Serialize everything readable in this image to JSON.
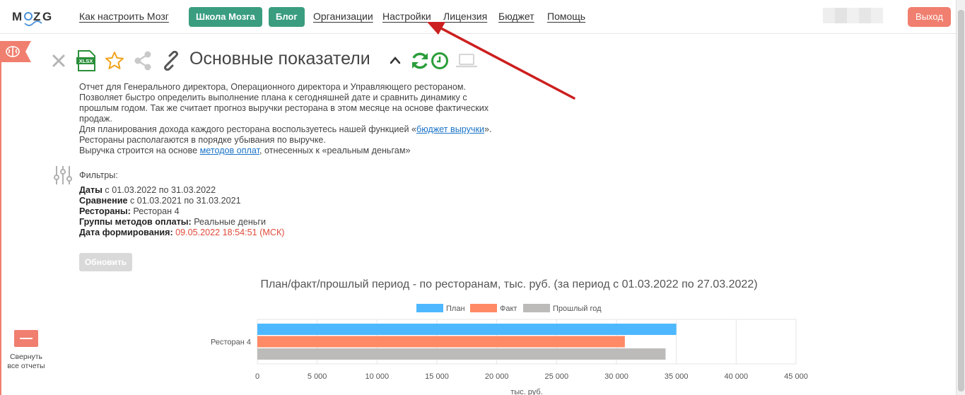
{
  "nav": {
    "logo": "MOZG",
    "link_howto": "Как настроить Мозг",
    "btn_school": "Школа Мозга",
    "btn_blog": "Блог",
    "link_orgs": "Организации",
    "link_settings": "Настройки",
    "link_license": "Лицензия",
    "link_budget": "Бюджет",
    "link_help": "Помощь",
    "logout": "Выход"
  },
  "report": {
    "title": "Основные показатели",
    "desc_lines": [
      "Отчет для Генерального директора, Операционного директора и Управляющего рестораном.",
      "Позволяет быстро определить выполнение плана к сегодняшней дате и сравнить динамику с",
      "прошлым годом. Так же считает прогноз выручки ресторана в этом месяце на основе фактических",
      "продаж."
    ],
    "desc_budget_prefix": "Для планирования дохода каждого ресторана воспользуетесь нашей функцией «",
    "desc_budget_link": "бюджет выручки",
    "desc_budget_suffix": "».",
    "desc_sort": "Рестораны располагаются в порядке убывания по выручке.",
    "desc_pay_prefix": "Выручка строится на основе ",
    "desc_pay_link": "методов оплат",
    "desc_pay_suffix": ", отнесенных к «реальным деньгам»"
  },
  "filters": {
    "title": "Фильтры:",
    "dates_label": "Даты",
    "dates_value": " с 01.03.2022 по 31.03.2022",
    "compare_label": "Сравнение",
    "compare_value": " с 01.03.2021 по 31.03.2021",
    "rest_label": "Рестораны:",
    "rest_value": " Ресторан 4",
    "paygroups_label": "Группы методов оплаты:",
    "paygroups_value": " Реальные деньги",
    "gen_label": "Дата формирования:",
    "gen_value": " 09.05.2022 18:54:51 (МСК)"
  },
  "buttons": {
    "refresh": "Обновить",
    "collapse_all": "Свернуть все отчеты"
  },
  "icons": {
    "close": "close-icon",
    "xlsx": "xlsx-icon",
    "star": "star-icon",
    "share": "share-icon",
    "link": "link-icon",
    "collapse": "chevron-up-icon",
    "refresh": "refresh-icon",
    "clock": "clock-icon",
    "laptop": "laptop-icon",
    "filters": "sliders-icon",
    "brain": "brain-icon"
  },
  "colors": {
    "accent_green": "#3a9d80",
    "logout": "#f07f6f",
    "plan": "#4db8ff",
    "fact": "#ff8a65",
    "prev": "#bdbaba",
    "annotation_arrow": "#cc1f1f"
  },
  "chart_data": {
    "type": "bar",
    "orientation": "horizontal",
    "title": "План/факт/прошлый период - по ресторанам, тыс. руб. (за период с 01.03.2022 по 27.03.2022)",
    "categories": [
      "Ресторан 4"
    ],
    "series": [
      {
        "name": "План",
        "values": [
          35000
        ]
      },
      {
        "name": "Факт",
        "values": [
          30700
        ]
      },
      {
        "name": "Прошлый год",
        "values": [
          34100
        ]
      }
    ],
    "xlabel": "тыс. руб.",
    "ylabel": "",
    "xlim": [
      0,
      45000
    ],
    "ticks": [
      "0",
      "5 000",
      "10 000",
      "15 000",
      "20 000",
      "25 000",
      "30 000",
      "35 000",
      "40 000",
      "45 000"
    ],
    "legend": "top",
    "grid": true
  }
}
